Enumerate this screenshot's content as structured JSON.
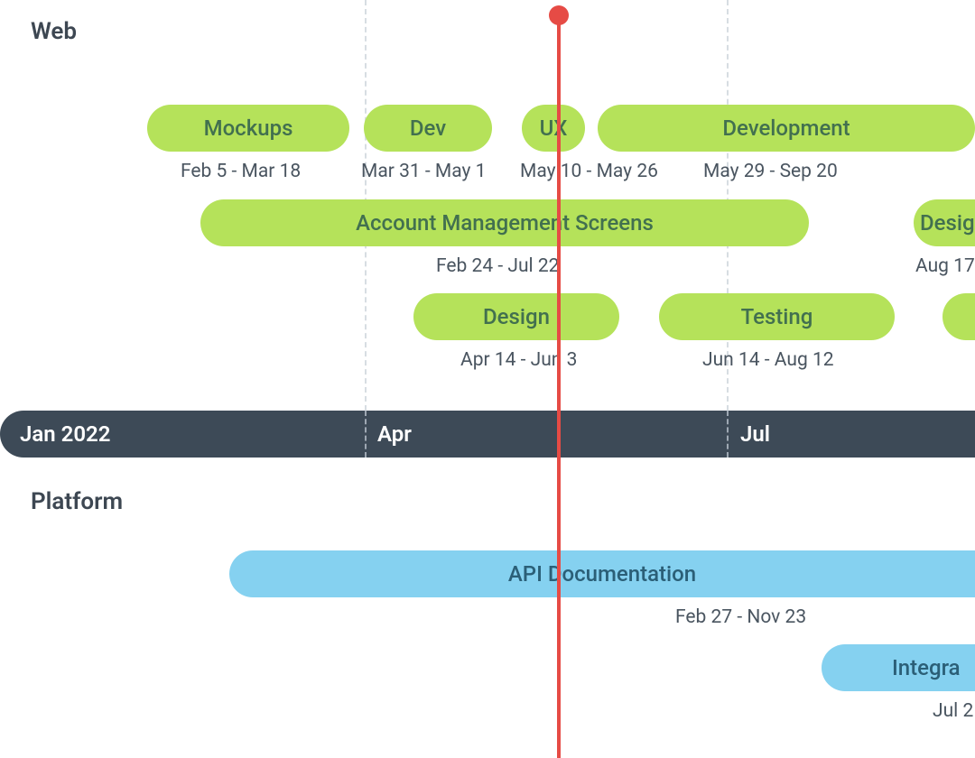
{
  "sections": {
    "web": {
      "label": "Web"
    },
    "platform": {
      "label": "Platform"
    }
  },
  "axis": {
    "ticks": [
      "Jan 2022",
      "Apr",
      "Jul"
    ]
  },
  "tasks": {
    "web": {
      "row1": [
        {
          "label": "Mockups",
          "dates": "Feb 5 - Mar 18"
        },
        {
          "label": "Dev",
          "dates": "Mar 31 - May 1"
        },
        {
          "label": "UX",
          "dates": "May 10 - May 26"
        },
        {
          "label": "Development",
          "dates": "May 29 - Sep 20"
        }
      ],
      "row2": [
        {
          "label": "Account Management Screens",
          "dates": "Feb 24 - Jul 22"
        },
        {
          "label": "Design",
          "dates": "Aug 17"
        }
      ],
      "row3": [
        {
          "label": "Design",
          "dates": "Apr 14 - Jun 3"
        },
        {
          "label": "Testing",
          "dates": "Jun 14 - Aug 12"
        },
        {
          "label": "",
          "dates": ""
        }
      ]
    },
    "platform": {
      "row1": [
        {
          "label": "API Documentation",
          "dates": "Feb 27 - Nov 23"
        }
      ],
      "row2": [
        {
          "label": "Integra",
          "dates": "Jul 2"
        }
      ]
    }
  }
}
